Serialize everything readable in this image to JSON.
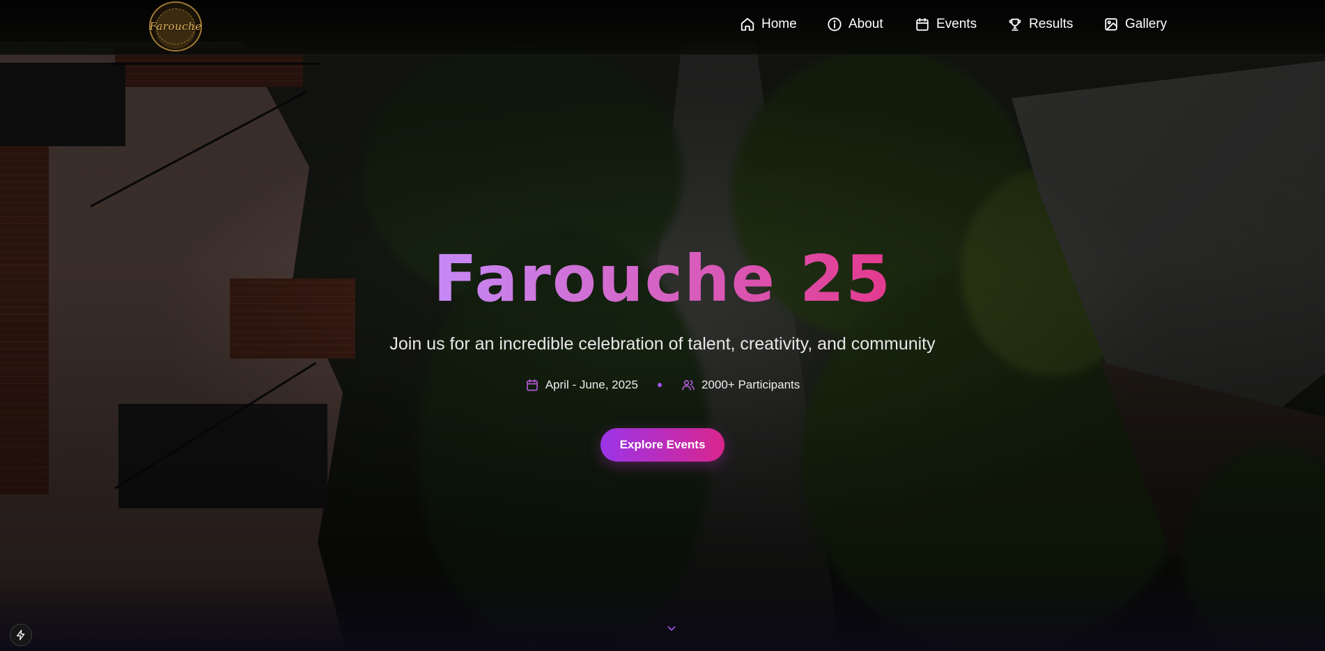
{
  "brand": {
    "logo_text": "Farouche"
  },
  "nav": {
    "items": [
      {
        "label": "Home",
        "icon": "home-icon"
      },
      {
        "label": "About",
        "icon": "info-icon"
      },
      {
        "label": "Events",
        "icon": "calendar-icon"
      },
      {
        "label": "Results",
        "icon": "trophy-icon"
      },
      {
        "label": "Gallery",
        "icon": "image-icon"
      }
    ]
  },
  "hero": {
    "title": "Farouche 25",
    "subtitle": "Join us for an incredible celebration of talent, creativity, and community",
    "date_text": "April - June, 2025",
    "participants_text": "2000+ Participants",
    "cta_label": "Explore Events"
  },
  "colors": {
    "accent_purple": "#a855f7",
    "accent_pink": "#e33a8e",
    "cta_gradient_start": "#9b34e8",
    "cta_gradient_end": "#d9268d"
  },
  "icons": {
    "scroll": "chevron-down-icon",
    "badge": "lightning-bolt-icon"
  }
}
